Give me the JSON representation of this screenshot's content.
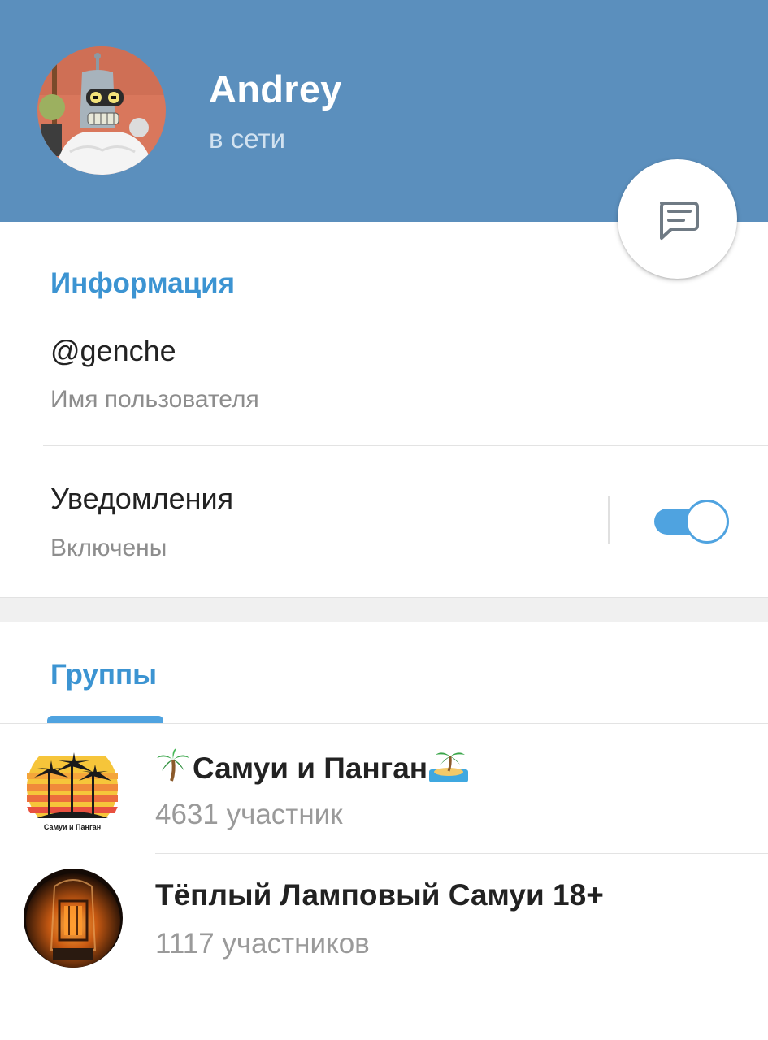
{
  "header": {
    "user_name": "Andrey",
    "status": "в сети",
    "avatar_icon": "bender-avatar",
    "fab_icon": "message-icon",
    "background_color": "#5b8fbd"
  },
  "info_section": {
    "title": "Информация",
    "username_value": "@genche",
    "username_label": "Имя пользователя",
    "notifications_title": "Уведомления",
    "notifications_state": "Включены",
    "notifications_enabled": true,
    "accent_color": "#3c94d2"
  },
  "groups_section": {
    "title": "Группы",
    "items": [
      {
        "name": "Самуи и Панган",
        "leading_emoji": "palm-tree-icon",
        "trailing_emoji": "desert-island-icon",
        "members": "4631 участник",
        "avatar_text": "Самуи и Панган"
      },
      {
        "name": "Тёплый Ламповый Самуи 18+",
        "members": "1117 участников",
        "avatar_icon": "vacuum-tube-avatar"
      }
    ]
  }
}
